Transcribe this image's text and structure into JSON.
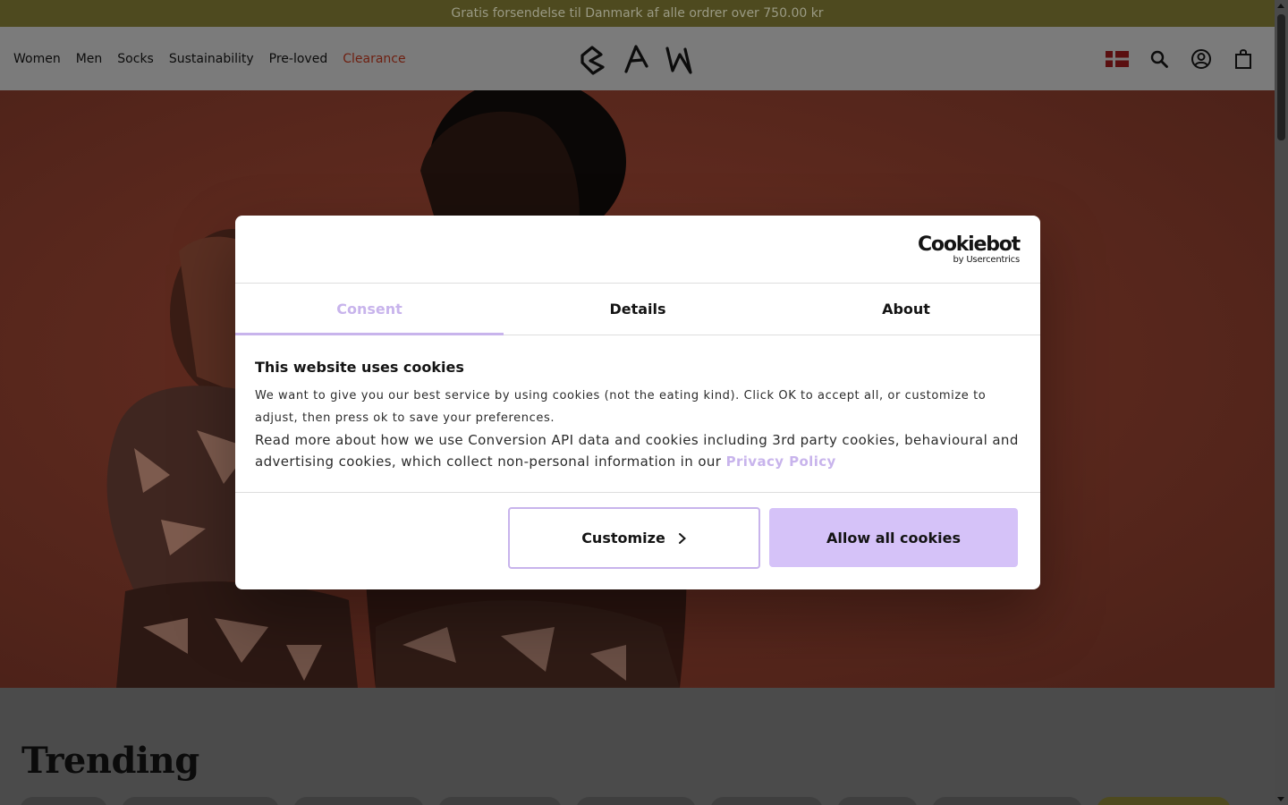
{
  "promo": {
    "text": "Gratis forsendelse til Danmark af alle ordrer over 750.00 kr"
  },
  "nav": {
    "items": [
      {
        "label": "Women"
      },
      {
        "label": "Men"
      },
      {
        "label": "Socks"
      },
      {
        "label": "Sustainability"
      },
      {
        "label": "Pre-loved"
      },
      {
        "label": "Clearance"
      }
    ],
    "logo_text": "BAM"
  },
  "header_icons": [
    "denmark-flag-icon",
    "search-icon",
    "account-icon",
    "bag-icon"
  ],
  "hero": {
    "image": "two women in camouflage activewear"
  },
  "trending": {
    "title": "Trending"
  },
  "cookie_dialog": {
    "brand": {
      "name": "Cookiebot",
      "sub": "by Usercentrics"
    },
    "tabs": [
      {
        "label": "Consent",
        "active": true
      },
      {
        "label": "Details",
        "active": false
      },
      {
        "label": "About",
        "active": false
      }
    ],
    "title": "This website uses cookies",
    "paragraph1": "We want to give you our best service by using cookies (not the eating kind). Click OK to accept all, or customize to adjust, then press ok to save your preferences.",
    "paragraph2": "Read more about how we use Conversion API data and cookies including 3rd party cookies, behavioural and advertising cookies, which collect non-personal information in our",
    "privacy_link": "Privacy Policy",
    "buttons": {
      "customize": "Customize",
      "allow_all": "Allow all cookies"
    }
  },
  "colors": {
    "accent": "#c8b4ec",
    "allow_button": "#d5c2f8",
    "clearance": "#6e1f10",
    "promo_bg": "#4e4a1f"
  }
}
